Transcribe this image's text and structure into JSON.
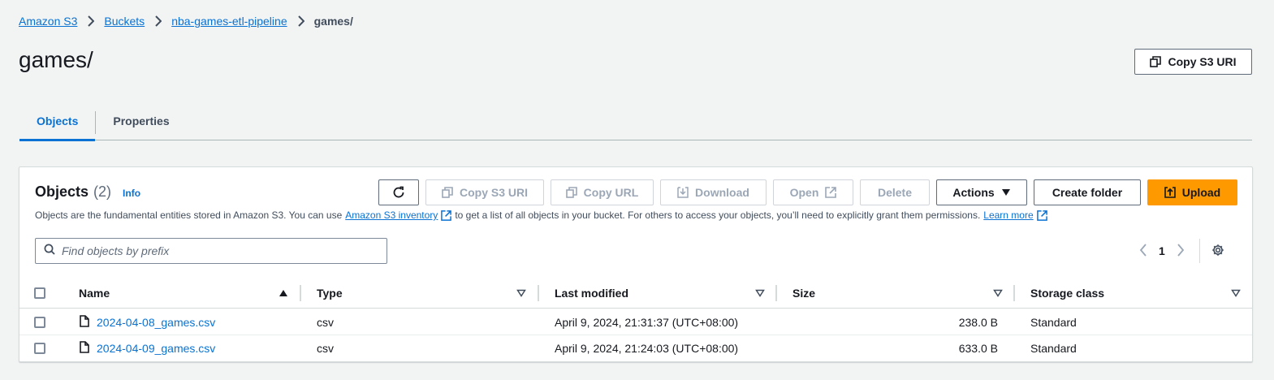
{
  "breadcrumb": {
    "items": [
      "Amazon S3",
      "Buckets",
      "nba-games-etl-pipeline"
    ],
    "current": "games/"
  },
  "page": {
    "title": "games/",
    "copy_s3_uri": "Copy S3 URI"
  },
  "tabs": [
    {
      "label": "Objects",
      "active": true
    },
    {
      "label": "Properties",
      "active": false
    }
  ],
  "objects_panel": {
    "title": "Objects",
    "count": "(2)",
    "info": "Info",
    "description": {
      "part1": "Objects are the fundamental entities stored in Amazon S3. You can use",
      "inventory_link": "Amazon S3 inventory",
      "part2": "to get a list of all objects in your bucket. For others to access your objects, you’ll need to explicitly grant them permissions.",
      "learn_more": "Learn more"
    },
    "toolbar": {
      "copy_s3_uri": "Copy S3 URI",
      "copy_url": "Copy URL",
      "download": "Download",
      "open": "Open",
      "delete": "Delete",
      "actions": "Actions",
      "create_folder": "Create folder",
      "upload": "Upload"
    },
    "search": {
      "placeholder": "Find objects by prefix",
      "value": ""
    },
    "pagination": {
      "page": "1"
    }
  },
  "table": {
    "columns": [
      "Name",
      "Type",
      "Last modified",
      "Size",
      "Storage class"
    ],
    "rows": [
      {
        "name": "2024-04-08_games.csv",
        "type": "csv",
        "last_modified": "April 9, 2024, 21:31:37 (UTC+08:00)",
        "size": "238.0 B",
        "storage_class": "Standard"
      },
      {
        "name": "2024-04-09_games.csv",
        "type": "csv",
        "last_modified": "April 9, 2024, 21:24:03 (UTC+08:00)",
        "size": "633.0 B",
        "storage_class": "Standard"
      }
    ]
  },
  "colors": {
    "accent": "#0972d3",
    "upload": "#ff9900",
    "text": "#16191f",
    "disabled": "#9ba7b6"
  }
}
